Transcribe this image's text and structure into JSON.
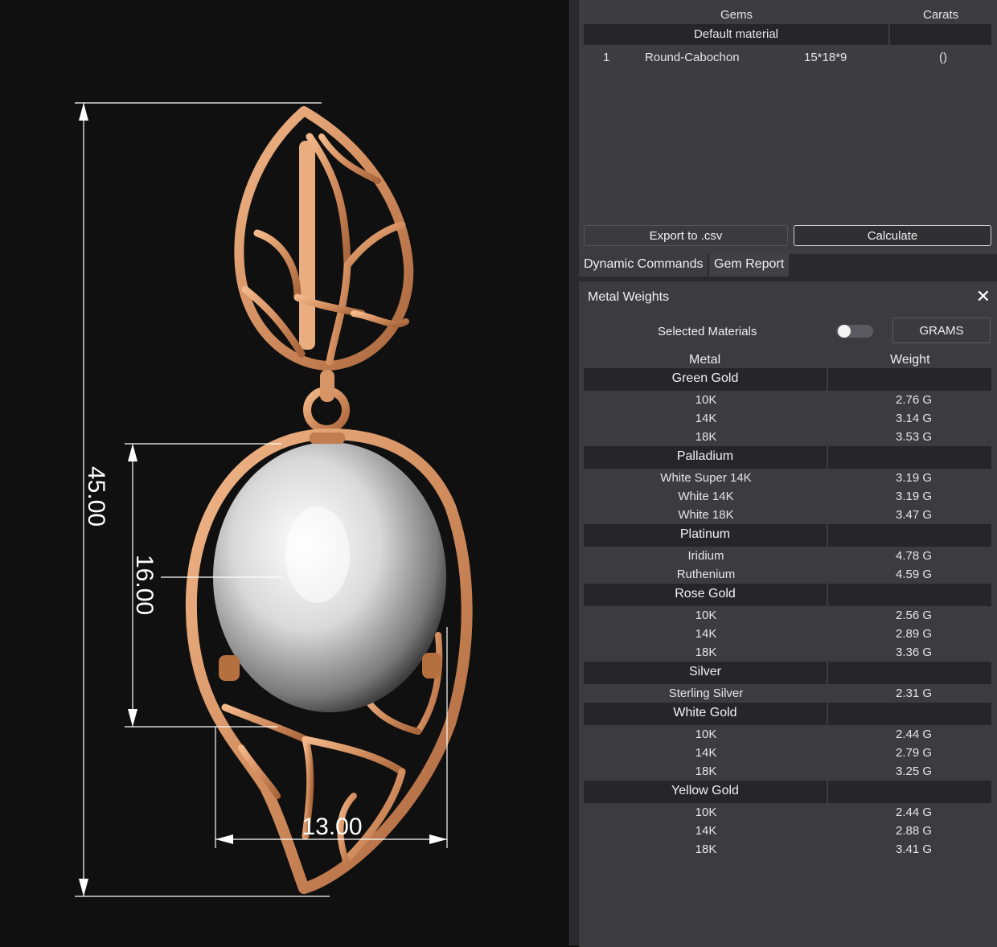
{
  "viewport": {
    "dimensions": {
      "height": "45.00",
      "stone": "16.00",
      "width": "13.00"
    },
    "colors": {
      "metal": "#d9956a",
      "background": "#101010",
      "stone": "#ffffff"
    }
  },
  "gems": {
    "header_gems": "Gems",
    "header_carats": "Carats",
    "material": "Default material",
    "rows": [
      {
        "num": "1",
        "shape": "Round-Cabochon",
        "size": "15*18*9",
        "carats": "()"
      }
    ],
    "export_label": "Export to .csv",
    "calculate_label": "Calculate"
  },
  "tabs": [
    {
      "label": "Dynamic Commands"
    },
    {
      "label": "Gem Report"
    }
  ],
  "metal_weights": {
    "title": "Metal Weights",
    "close_icon": "close-icon",
    "selected_label": "Selected Materials",
    "toggle_on": false,
    "units": "GRAMS",
    "col_metal": "Metal",
    "col_weight": "Weight",
    "groups": [
      {
        "name": "Green Gold",
        "items": [
          {
            "metal": "10K",
            "weight": "2.76 G"
          },
          {
            "metal": "14K",
            "weight": "3.14 G"
          },
          {
            "metal": "18K",
            "weight": "3.53 G"
          }
        ]
      },
      {
        "name": "Palladium",
        "items": [
          {
            "metal": "White Super 14K",
            "weight": "3.19 G"
          },
          {
            "metal": "White 14K",
            "weight": "3.19 G"
          },
          {
            "metal": "White 18K",
            "weight": "3.47 G"
          }
        ]
      },
      {
        "name": "Platinum",
        "items": [
          {
            "metal": "Iridium",
            "weight": "4.78 G"
          },
          {
            "metal": "Ruthenium",
            "weight": "4.59 G"
          }
        ]
      },
      {
        "name": "Rose Gold",
        "items": [
          {
            "metal": "10K",
            "weight": "2.56 G"
          },
          {
            "metal": "14K",
            "weight": "2.89 G"
          },
          {
            "metal": "18K",
            "weight": "3.36 G"
          }
        ]
      },
      {
        "name": "Silver",
        "items": [
          {
            "metal": "Sterling Silver",
            "weight": "2.31 G"
          }
        ]
      },
      {
        "name": "White Gold",
        "items": [
          {
            "metal": "10K",
            "weight": "2.44 G"
          },
          {
            "metal": "14K",
            "weight": "2.79 G"
          },
          {
            "metal": "18K",
            "weight": "3.25 G"
          }
        ]
      },
      {
        "name": "Yellow Gold",
        "items": [
          {
            "metal": "10K",
            "weight": "2.44 G"
          },
          {
            "metal": "14K",
            "weight": "2.88 G"
          },
          {
            "metal": "18K",
            "weight": "3.41 G"
          }
        ]
      }
    ]
  }
}
